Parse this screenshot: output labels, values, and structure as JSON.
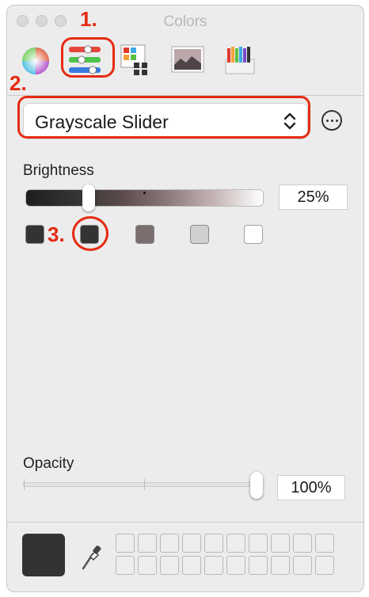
{
  "window": {
    "title": "Colors"
  },
  "toolbar": {
    "tabs": [
      {
        "name": "color-wheel",
        "icon": "color-wheel-icon"
      },
      {
        "name": "color-sliders",
        "icon": "color-sliders-icon",
        "selected": true
      },
      {
        "name": "color-palettes",
        "icon": "color-palettes-icon"
      },
      {
        "name": "image-palettes",
        "icon": "image-palettes-icon"
      },
      {
        "name": "pencils",
        "icon": "pencils-icon"
      }
    ]
  },
  "slider_mode": {
    "selected": "Grayscale Slider"
  },
  "brightness": {
    "label": "Brightness",
    "value_text": "25%",
    "level": 0.25
  },
  "preset_swatches": [
    "#333333",
    "#333333",
    "#7a6e6e",
    "#d0d0d0",
    "#ffffff"
  ],
  "opacity": {
    "label": "Opacity",
    "value_text": "100%",
    "level": 1.0
  },
  "current_color": "#333333",
  "annotations": {
    "step1": "1.",
    "step2": "2.",
    "step3": "3.",
    "accent": "#e52b12"
  }
}
